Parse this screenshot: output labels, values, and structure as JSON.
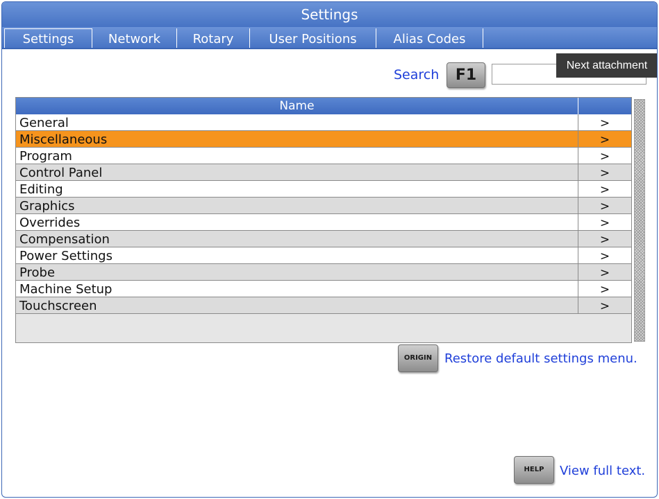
{
  "window": {
    "title": "Settings"
  },
  "tabs": [
    {
      "label": "Settings",
      "active": true
    },
    {
      "label": "Network"
    },
    {
      "label": "Rotary"
    },
    {
      "label": "User Positions"
    },
    {
      "label": "Alias Codes"
    }
  ],
  "search": {
    "label": "Search",
    "key_label": "F1",
    "value": "",
    "tooltip": "Next attachment"
  },
  "table": {
    "column_name": "Name",
    "rows": [
      {
        "name": "General",
        "arrow": ">"
      },
      {
        "name": "Miscellaneous",
        "arrow": ">",
        "selected": true
      },
      {
        "name": "Program",
        "arrow": ">"
      },
      {
        "name": "Control Panel",
        "arrow": ">"
      },
      {
        "name": "Editing",
        "arrow": ">"
      },
      {
        "name": "Graphics",
        "arrow": ">"
      },
      {
        "name": "Overrides",
        "arrow": ">"
      },
      {
        "name": "Compensation",
        "arrow": ">"
      },
      {
        "name": "Power Settings",
        "arrow": ">"
      },
      {
        "name": "Probe",
        "arrow": ">"
      },
      {
        "name": "Machine Setup",
        "arrow": ">"
      },
      {
        "name": "Touchscreen",
        "arrow": ">"
      }
    ]
  },
  "actions": {
    "origin_key": "ORIGIN",
    "origin_text": "Restore default settings menu.",
    "help_key": "HELP",
    "help_text": "View full text."
  },
  "colors": {
    "accent": "#4773c4",
    "selected_row": "#f6941d",
    "link": "#1f3fd9"
  }
}
